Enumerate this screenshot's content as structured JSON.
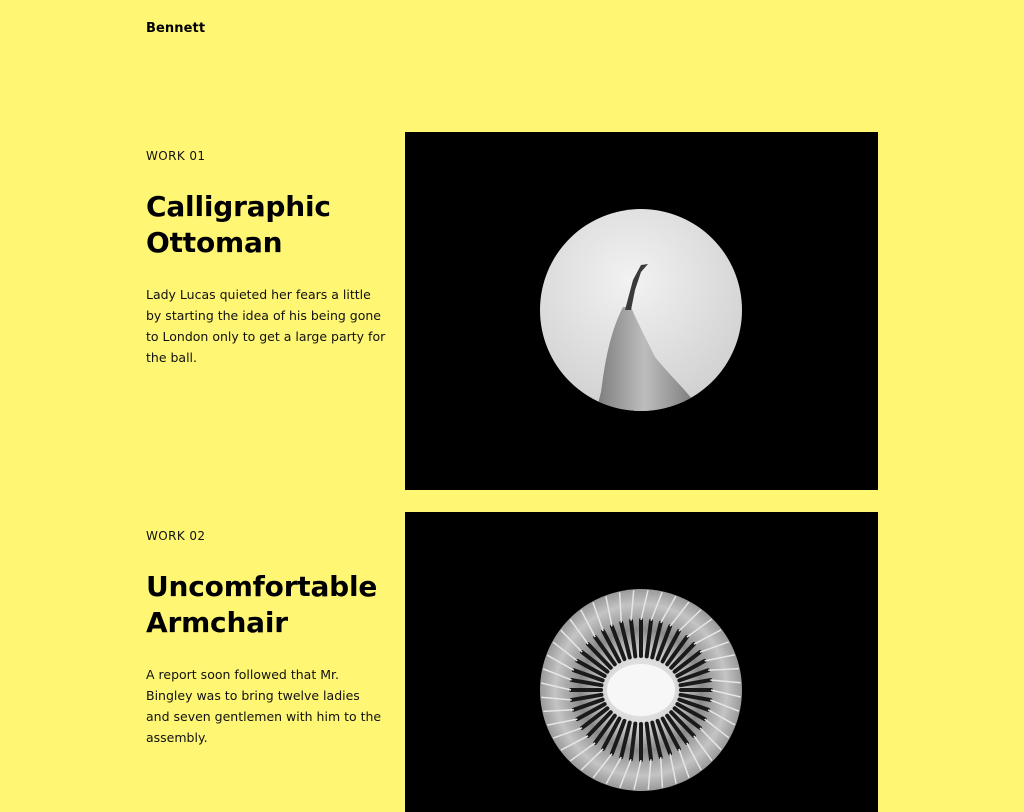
{
  "site": {
    "title": "Bennett"
  },
  "works": [
    {
      "label": "WORK 01",
      "title_line1": "Calligraphic",
      "title_line2": "Ottoman",
      "description": "Lady Lucas quieted her fears a little by starting the idea of his being gone to London only to get a large party for the ball.",
      "image_icon": "pear-photo"
    },
    {
      "label": "WORK 02",
      "title_line1": "Uncomfortable",
      "title_line2": "Armchair",
      "description": "A report soon followed that Mr. Bingley was to bring twelve ladies and seven gentlemen with him to the assembly.",
      "image_icon": "kiwi-photo"
    }
  ],
  "colors": {
    "background": "#fff674",
    "image_background": "#000000",
    "text": "#111111"
  }
}
